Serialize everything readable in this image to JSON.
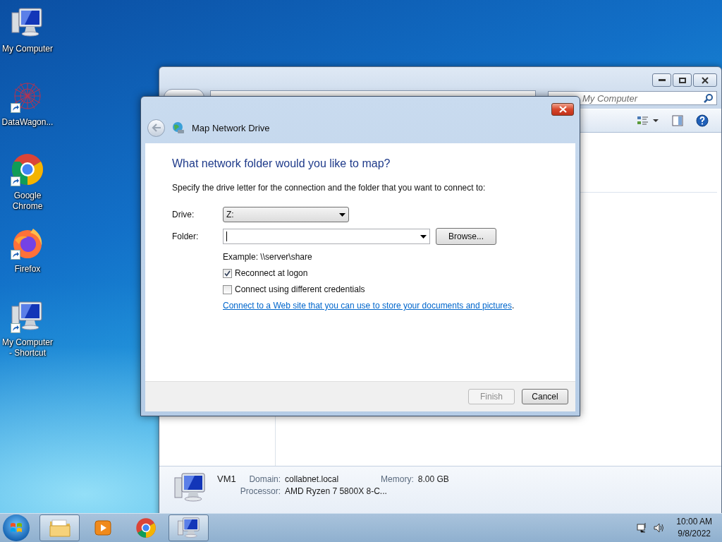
{
  "desktop_icons": [
    {
      "kind": "computer",
      "label": "My Computer",
      "shortcut": false
    },
    {
      "kind": "graph",
      "label": "DataWagon...",
      "shortcut": true
    },
    {
      "kind": "chrome",
      "label": "Google Chrome",
      "shortcut": true
    },
    {
      "kind": "firefox",
      "label": "Firefox",
      "shortcut": true
    },
    {
      "kind": "computer",
      "label": "My Computer - Shortcut",
      "shortcut": true
    }
  ],
  "explorer": {
    "search": {
      "placeholder": "My Computer"
    },
    "details": {
      "name": "VM1",
      "fields": [
        {
          "label": "Domain:",
          "value": "collabnet.local"
        },
        {
          "label": "Memory:",
          "value": "8.00 GB"
        },
        {
          "label": "Processor:",
          "value": "AMD Ryzen 7 5800X 8-C..."
        }
      ]
    }
  },
  "dialog": {
    "title": "Map Network Drive",
    "close_hovered": true,
    "heading": "What network folder would you like to map?",
    "instruction": "Specify the drive letter for the connection and the folder that you want to connect to:",
    "drive": {
      "label": "Drive:",
      "value": "Z:"
    },
    "folder": {
      "label": "Folder:",
      "focused": true
    },
    "browse": "Browse...",
    "example": "Example: \\\\server\\share",
    "options": [
      {
        "label": "Reconnect at logon",
        "checked": true
      },
      {
        "label": "Connect using different credentials",
        "checked": false
      }
    ],
    "link": {
      "text": "Connect to a Web site that you can use to store your documents and pictures",
      "after": "."
    },
    "buttons": [
      {
        "label": "Finish",
        "disabled": true
      },
      {
        "label": "Cancel",
        "disabled": false
      }
    ]
  },
  "taskbar": {
    "items": [
      {
        "kind": "explorer",
        "running": true
      },
      {
        "kind": "media",
        "running": false
      },
      {
        "kind": "chrome",
        "running": false
      },
      {
        "kind": "remote",
        "running": true
      }
    ],
    "clock": {
      "time": "10:00 AM",
      "date": "9/8/2022"
    }
  }
}
